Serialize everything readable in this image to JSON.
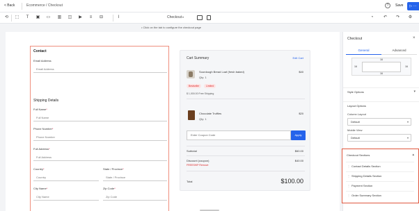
{
  "topbar": {
    "back_label": "< Back",
    "breadcrumb": "Ecommerce / Checkout",
    "help_glyph": "?",
    "save_label": "Save",
    "publish_label": "▷ ···"
  },
  "toolbar": {
    "icons": [
      "undo-history-icon",
      "frame-icon",
      "text-icon",
      "image-icon",
      "button-icon",
      "layout-icon",
      "container-icon",
      "video-icon",
      "divider-icon",
      "slider-icon",
      "text-cursor-icon"
    ],
    "layout_select": "Checkout",
    "right_icons": [
      "history-icon",
      "undo-icon",
      "redo-icon",
      "settings-icon"
    ]
  },
  "notice": {
    "text": "• Click on the tab to configure the checkout page"
  },
  "form": {
    "contact_heading": "Contact",
    "email_label": "Email Address",
    "email_placeholder": "Email Address",
    "shipping_heading": "Shipping Details",
    "full_name_label": "Full Name",
    "full_name_placeholder": "Full Name",
    "phone_label": "Phone Number",
    "phone_placeholder": "Phone Number",
    "address_label": "Full Address",
    "address_placeholder": "Full Address",
    "country_label": "Country",
    "country_placeholder": "Country",
    "state_label": "State / Province",
    "state_placeholder": "State / Province",
    "city_label": "City Name",
    "city_placeholder": "City Name",
    "zip_label": "Zip Code",
    "zip_placeholder": "Zip Code"
  },
  "summary": {
    "heading": "Cart Summary",
    "edit_label": "Edit Cart",
    "item1_name": "Sourdough Bread Loaf (fresh baked)",
    "item1_qty": "Qty: 1",
    "item1_price": "$40",
    "pill1": "Bestseller",
    "pill2": "Limited",
    "item1_note": "$ 1,000.00 Free Shipping",
    "item2_name": "Chocolate Truffles",
    "item2_qty": "Qty: 1",
    "item2_price": "$20",
    "coupon_placeholder": "Enter Coupon Code",
    "apply_label": "Apply",
    "subtotal_label": "Subtotal",
    "subtotal_value": "$60.00",
    "discount_label": "Discount (coupon)",
    "discount_note": "FREESHIP  Remove",
    "discount_value": "$40.00",
    "total_label": "Total",
    "total_value": "$100.00"
  },
  "panel": {
    "title": "Checkout",
    "tab_general": "General",
    "tab_advanced": "Advanced",
    "bm_top": "16",
    "bm_right": "16",
    "bm_bottom": "16",
    "bm_left": "16",
    "section_style": "Style Options",
    "section_layout": "Layout Options",
    "column_layout_label": "Column Layout",
    "column_layout_value": "Default",
    "mobile_view_label": "Mobile View",
    "mobile_view_value": "Default",
    "sections_heading": "Checkout Sections",
    "sections": [
      "Contact Details Section",
      "Shipping Details Section",
      "Payment Section",
      "Order Summary Section"
    ]
  }
}
